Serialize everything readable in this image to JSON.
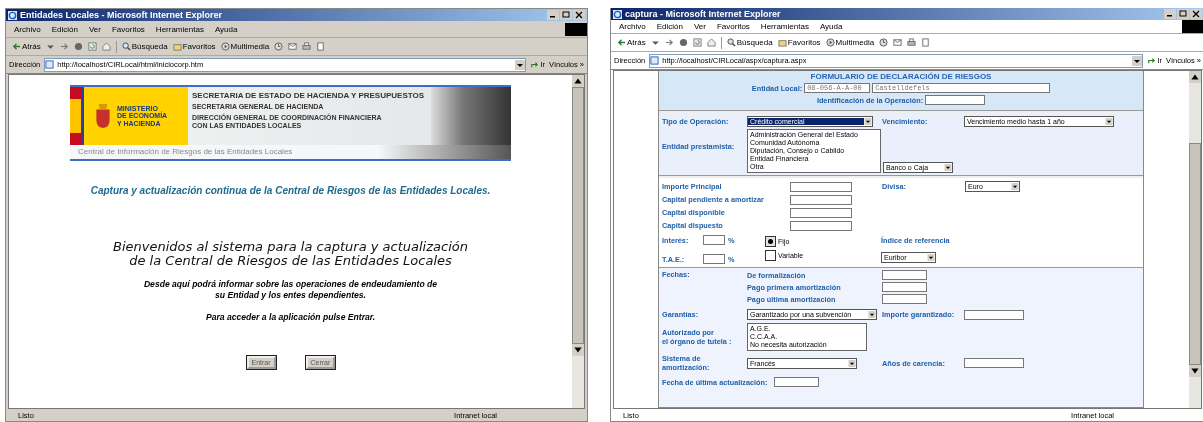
{
  "windows": [
    {
      "kind": "welcome",
      "title": "Entidades Locales - Microsoft Internet Explorer",
      "menu": [
        "Archivo",
        "Edición",
        "Ver",
        "Favoritos",
        "Herramientas",
        "Ayuda"
      ],
      "toolbar": {
        "back": "Atrás",
        "search": "Búsqueda",
        "favorites": "Favoritos",
        "media": "Multimedia"
      },
      "address": {
        "label": "Dirección",
        "url": "http://localhost/CIRLocal/html/iniciocorp.htm",
        "go": "Ir",
        "links": "Vínculos »"
      },
      "status": {
        "text": "Listo",
        "zone": "Intranet local"
      },
      "welcome": {
        "banner": {
          "ministry_lines": [
            "MINISTERIO",
            "DE ECONOMÍA",
            "Y HACIENDA"
          ],
          "lines": [
            "SECRETARIA DE ESTADO DE HACIENDA Y PRESUPUESTOS",
            "SECRETARIA GENERAL DE HACIENDA",
            "DIRECCIÓN GENERAL DE COORDINACIÓN FINANCIERA",
            "CON LAS ENTIDADES LOCALES"
          ],
          "caption": "Central de Información de Riesgos de las Entidades Locales"
        },
        "tagline": "Captura y actualización continua de la Central de Riesgos de las Entidades Locales.",
        "heading_lines": [
          "Bienvenidos al sistema para la captura y actualización",
          "de la Central de Riesgos de las Entidades Locales"
        ],
        "intro_lines": [
          "Desde aquí podrá informar sobre las operaciones de endeudamiento  de",
          "su Entidad y los entes dependientes."
        ],
        "instruction": "Para acceder a la aplicación pulse Entrar.",
        "buttons": [
          "Entrar",
          "Cerrar"
        ]
      }
    },
    {
      "kind": "form",
      "title": "captura - Microsoft Internet Explorer",
      "menu": [
        "Archivo",
        "Edición",
        "Ver",
        "Favoritos",
        "Herramientas",
        "Ayuda"
      ],
      "toolbar": {
        "back": "Atrás",
        "search": "Búsqueda",
        "favorites": "Favoritos",
        "media": "Multimedia"
      },
      "address": {
        "label": "Dirección",
        "url": "http://localhost/CIRLocal/aspx/captura.aspx",
        "go": "Ir",
        "links": "Vínculos »"
      },
      "status": {
        "text": "Listo",
        "zone": "Intranet local"
      },
      "form": {
        "title": "FORMULARIO DE DECLARACIÓN DE RIESGOS",
        "entity": {
          "label": "Entidad Local:",
          "code": "08-056-A-A-00",
          "name": "Castelldefels"
        },
        "operation_id": {
          "label": "Identificación de la Operación:"
        },
        "operation_type": {
          "label": "Tipo de Operación:",
          "value": "Crédito comercial"
        },
        "maturity": {
          "label": "Vencimiento:",
          "value": "Vencimiento medio hasta 1 año"
        },
        "lender": {
          "label": "Entidad prestamista:",
          "options": [
            "Administración General del Estado",
            "Comunidad Autónoma",
            "Diputación, Consejo o Cabildo",
            "Entidad Financiera",
            "Otra"
          ],
          "subtype": "Banco o Caja"
        },
        "amounts": [
          {
            "label": "Importe  Principal"
          },
          {
            "label": "Capital pendiente a amortizar"
          },
          {
            "label": "Capital   disponible"
          },
          {
            "label": "Capital dispuesto"
          }
        ],
        "currency": {
          "label": "Divisa:",
          "value": "Euro"
        },
        "rates": [
          {
            "label": "Interés:",
            "unit": "%"
          },
          {
            "label": "T.A.E.:",
            "unit": "%"
          }
        ],
        "rate_types": [
          {
            "label": "Fijo",
            "selected": true
          },
          {
            "label": "Variable",
            "selected": false
          }
        ],
        "reference_index": {
          "label": "Índice de referencia",
          "value": "Euribor"
        },
        "dates": {
          "label": "Fechas:",
          "items": [
            {
              "label": "De formalización"
            },
            {
              "label": "Pago primera amortización"
            },
            {
              "label": "Pago última amortización"
            }
          ]
        },
        "guarantees": {
          "label": "Garantías:",
          "value": "Garantizado por una subvención"
        },
        "guaranteed_amount": {
          "label": "Importe garantizado:"
        },
        "authorization": {
          "label_lines": [
            "Autorizado por",
            "el órgano de tutela :"
          ],
          "options": [
            "A.G.E.",
            "C.C.A.A.",
            "No necesita autorización"
          ]
        },
        "amortization_system": {
          "label_lines": [
            "Sistema de",
            "amortización:"
          ],
          "value": "Francés"
        },
        "grace_years": {
          "label": "Años de carencia:"
        },
        "last_update": {
          "label": "Fecha de última actualización:"
        }
      }
    }
  ]
}
